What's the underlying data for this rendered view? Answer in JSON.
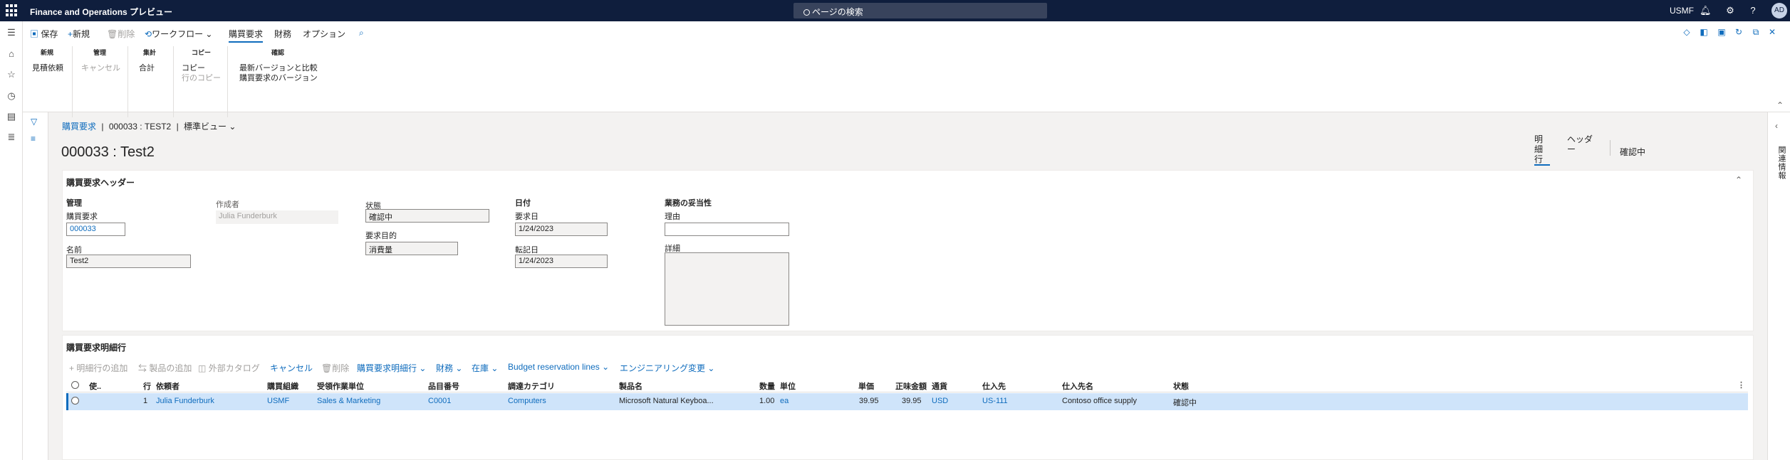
{
  "topbar": {
    "app_title": "Finance and Operations プレビュー",
    "search_placeholder": "ページの検索",
    "company": "USMF",
    "avatar_initials": "AD"
  },
  "action_tabs": {
    "save": "保存",
    "new": "新規",
    "delete": "削除",
    "workflow": "ワークフロー",
    "purchase_requisition": "購買要求",
    "finance": "財務",
    "options": "オプション"
  },
  "groups": {
    "new": {
      "header": "新規",
      "items": [
        "見積依頼"
      ]
    },
    "manage": {
      "header": "管理",
      "items": [
        "キャンセル"
      ]
    },
    "totals": {
      "header": "集計",
      "items": [
        "合計"
      ]
    },
    "copy": {
      "header": "コピー",
      "items": [
        "コピー",
        "行のコピー"
      ]
    },
    "confirm": {
      "header": "確認",
      "items": [
        "最新バージョンと比較",
        "購買要求のバージョン"
      ]
    }
  },
  "breadcrumb": {
    "root": "購買要求",
    "separator": "|",
    "record": "000033 : TEST2",
    "view": "標準ビュー"
  },
  "page_title": "000033 : Test2",
  "view_tabs": {
    "lines": "明細行",
    "header": "ヘッダー",
    "status": "確認中"
  },
  "header_card": {
    "title": "購買要求ヘッダー",
    "manage_label": "管理",
    "requisition_label": "購買要求",
    "requisition_value": "000033",
    "name_label": "名前",
    "name_value": "Test2",
    "preparer_label": "作成者",
    "preparer_value": "Julia Funderburk",
    "status_label": "状態",
    "status_value": "確認中",
    "purpose_label": "要求目的",
    "purpose_value": "消費量",
    "date_group": "日付",
    "requested_date_label": "要求日",
    "requested_date_value": "1/24/2023",
    "accounting_date_label": "転記日",
    "accounting_date_value": "1/24/2023",
    "justification_group": "業務の妥当性",
    "reason_label": "理由",
    "reason_value": "",
    "details_label": "詳細",
    "details_value": ""
  },
  "lines_card": {
    "title": "購買要求明細行",
    "toolbar": {
      "add_line": "明細行の追加",
      "add_products": "製品の追加",
      "external_catalog": "外部カタログ",
      "cancel": "キャンセル",
      "delete": "削除",
      "requisition_line": "購買要求明細行",
      "financials": "財務",
      "inventory": "在庫",
      "budget": "Budget reservation lines",
      "engineering": "エンジニアリング変更"
    },
    "columns": [
      "使..",
      "行",
      "依頼者",
      "購買組織",
      "受領作業単位",
      "品目番号",
      "調達カテゴリ",
      "製品名",
      "数量",
      "単位",
      "単価",
      "正味金額",
      "通貨",
      "仕入先",
      "仕入先名",
      "状態"
    ],
    "rows": [
      {
        "line": "1",
        "requester": "Julia Funderburk",
        "buying_entity": "USMF",
        "receiving_unit": "Sales & Marketing",
        "item": "C0001",
        "category": "Computers",
        "product": "Microsoft Natural Keyboa...",
        "qty": "1.00",
        "unit": "ea",
        "price": "39.95",
        "net_amount": "39.95",
        "currency": "USD",
        "vendor": "US-111",
        "vendor_name": "Contoso office supply",
        "status": "確認中"
      }
    ]
  }
}
